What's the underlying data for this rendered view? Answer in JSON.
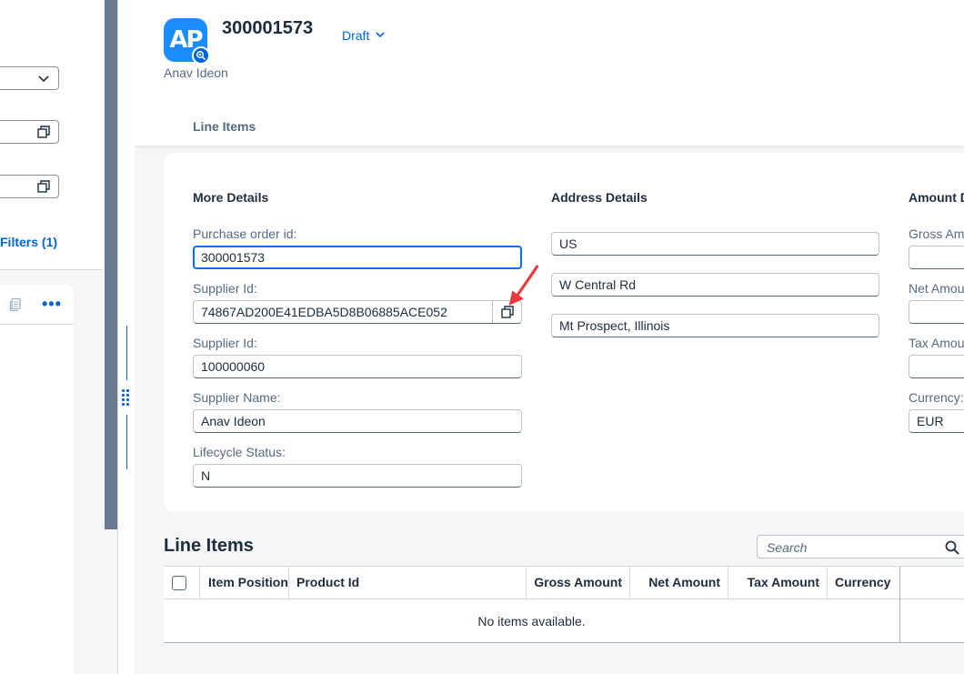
{
  "left_pane": {
    "filters_link": "Filters (1)"
  },
  "header": {
    "avatar_text": "AP",
    "title": "300001573",
    "status": "Draft",
    "subtitle": "Anav Ideon",
    "tab": "Line Items"
  },
  "more_details": {
    "title": "More Details",
    "fields": [
      {
        "label": "Purchase order id:",
        "value": "300001573"
      },
      {
        "label": "Supplier Id:",
        "value": "74867AD200E41EDBA5D8B06885ACE052"
      },
      {
        "label": "Supplier Id:",
        "value": "100000060"
      },
      {
        "label": "Supplier Name:",
        "value": "Anav Ideon"
      },
      {
        "label": "Lifecycle Status:",
        "value": "N"
      }
    ]
  },
  "address_details": {
    "title": "Address Details",
    "lines": [
      "US",
      "W Central Rd",
      "Mt Prospect, Illinois"
    ]
  },
  "amount_details": {
    "title": "Amount D",
    "fields": [
      {
        "label": "Gross Amo",
        "value": ""
      },
      {
        "label": "Net Amou",
        "value": ""
      },
      {
        "label": "Tax Amou",
        "value": ""
      },
      {
        "label": "Currency:",
        "value": "EUR"
      }
    ]
  },
  "line_items": {
    "title": "Line Items",
    "search_placeholder": "Search",
    "columns": [
      "Item Position",
      "Product Id",
      "Gross Amount",
      "Net Amount",
      "Tax Amount",
      "Currency"
    ],
    "empty_text": "No items available."
  },
  "colors": {
    "accent": "#0064d9",
    "annotation_arrow": "#e8393d",
    "divider": "#6a7a91"
  }
}
